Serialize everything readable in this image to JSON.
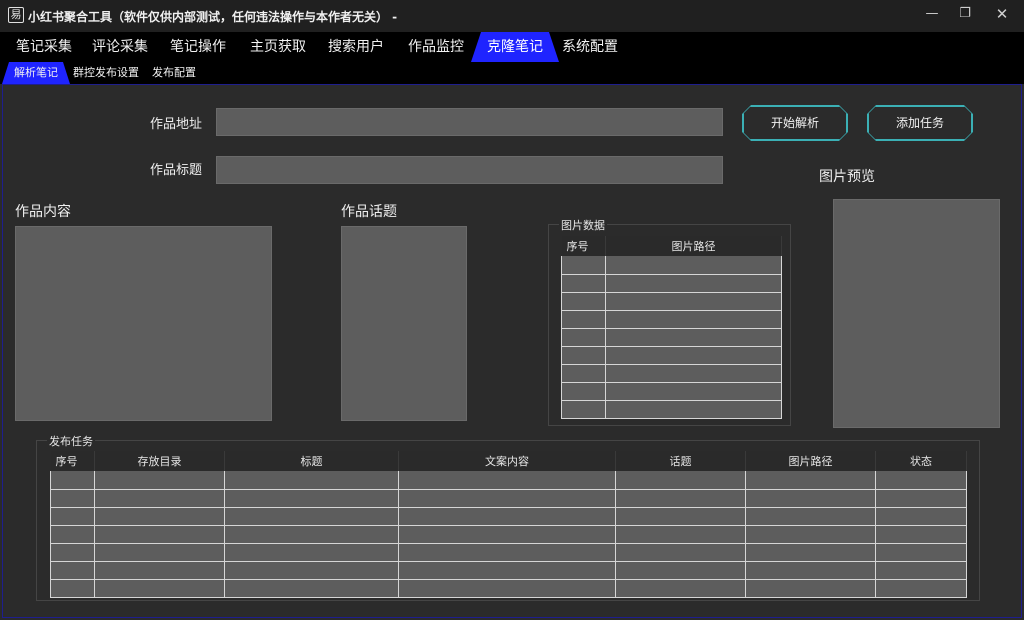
{
  "window": {
    "icon_glyph": "易",
    "title": "小红书聚合工具（软件仅供内部测试，任何违法操作与本作者无关） -",
    "minimize_glyph": "—",
    "maximize_glyph": "❐",
    "close_glyph": "✕"
  },
  "menu": {
    "items": [
      "笔记采集",
      "评论采集",
      "笔记操作",
      "主页获取",
      "搜索用户",
      "作品监控",
      "克隆笔记",
      "系统配置"
    ],
    "active": "克隆笔记"
  },
  "subtabs": {
    "items": [
      "解析笔记",
      "群控发布设置",
      "发布配置"
    ],
    "active": "解析笔记"
  },
  "form": {
    "url_label": "作品地址",
    "url_value": "",
    "title_label": "作品标题",
    "title_value": "",
    "parse_button": "开始解析",
    "add_task_button": "添加任务",
    "content_label": "作品内容",
    "topic_label": "作品话题",
    "preview_label": "图片预览"
  },
  "image_data": {
    "group_title": "图片数据",
    "columns": [
      "序号",
      "图片路径"
    ],
    "row_count_visible": 9
  },
  "tasks": {
    "group_title": "发布任务",
    "columns": [
      "序号",
      "存放目录",
      "标题",
      "文案内容",
      "话题",
      "图片路径",
      "状态"
    ],
    "row_count_visible": 7
  },
  "colors": {
    "accent_tab": "#1f24ff",
    "button_border": "#3bb0b5",
    "field_bg": "#5d5d5d",
    "bg": "#2b2b2b"
  }
}
